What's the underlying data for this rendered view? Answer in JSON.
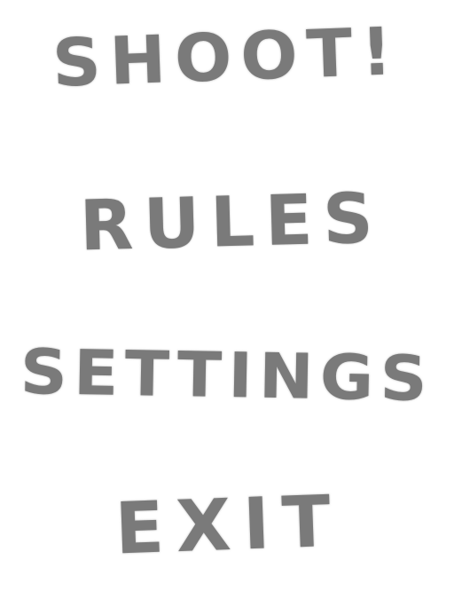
{
  "menu": {
    "items": [
      {
        "label": "SHOOT!"
      },
      {
        "label": "RULES"
      },
      {
        "label": "SETTINGS"
      },
      {
        "label": "EXIT"
      }
    ]
  },
  "colors": {
    "background": "#ffffff",
    "text": "#7a7a7a"
  }
}
